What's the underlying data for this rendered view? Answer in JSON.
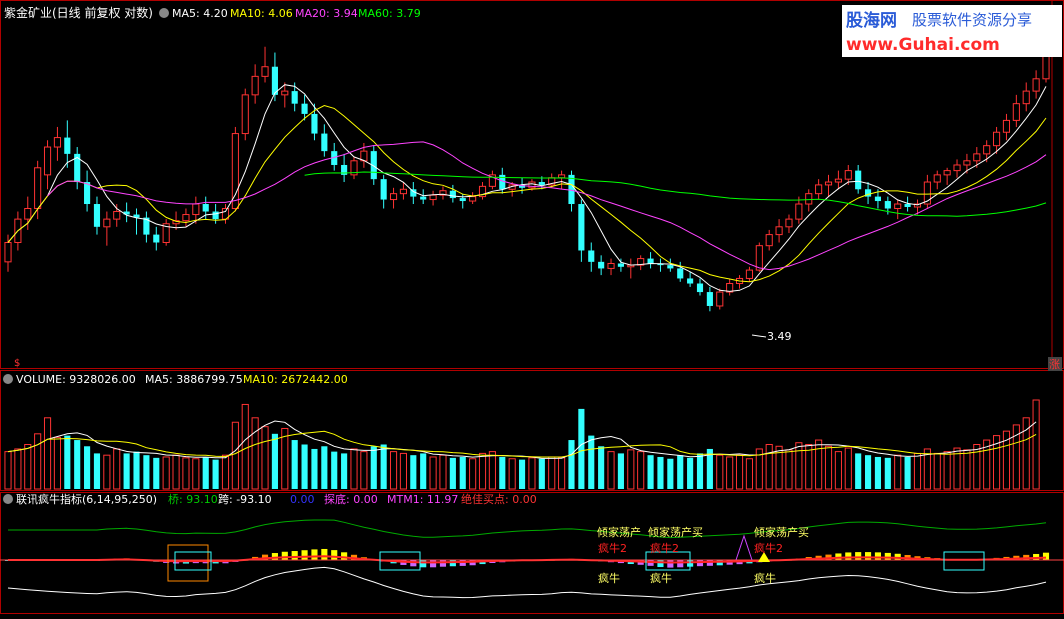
{
  "main_panel": {
    "title": "紫金矿业(日线 前复权 对数)",
    "ma_labels": [
      {
        "text": "MA5: 4.20",
        "color": "#ffffff"
      },
      {
        "text": "MA10: 4.06",
        "color": "#ffff00"
      },
      {
        "text": "MA20: 3.94",
        "color": "#ff44ff"
      },
      {
        "text": "MA60: 3.79",
        "color": "#00ff00"
      }
    ],
    "low_marker": "3.49",
    "left_flag": "$",
    "right_flag": "涨"
  },
  "volume_panel": {
    "labels": [
      {
        "text": "VOLUME: 9328026.00",
        "color": "#ffffff"
      },
      {
        "text": "MA5: 3886799.75",
        "color": "#ffffff"
      },
      {
        "text": "MA10: 2672442.00",
        "color": "#ffff00"
      }
    ]
  },
  "indicator_panel": {
    "labels": [
      {
        "text": "联讯疯牛指标(6,14,95,250)",
        "color": "#ffffff"
      },
      {
        "text": "桥: 93.10",
        "color": "#00cc00"
      },
      {
        "text": "跨: -93.10",
        "color": "#ffffff"
      },
      {
        "text": "0.00",
        "color": "#3333ff"
      },
      {
        "text": "探底: 0.00",
        "color": "#ff44ff"
      },
      {
        "text": "MTM1: 11.97",
        "color": "#ff44ff"
      },
      {
        "text": "绝佳买点: 0.00",
        "color": "#ff3333"
      }
    ],
    "signals": [
      {
        "text": "倾家荡产",
        "color": "#ffff66"
      },
      {
        "text": "疯牛2",
        "color": "#ff2222"
      },
      {
        "text": "疯牛",
        "color": "#ffff66"
      },
      {
        "text": "倾家荡产买",
        "color": "#ffff66"
      },
      {
        "text": "疯牛2",
        "color": "#ff2222"
      },
      {
        "text": "疯牛",
        "color": "#ffff66"
      },
      {
        "text": "倾家荡产买",
        "color": "#ffff66"
      },
      {
        "text": "疯牛2",
        "color": "#ff2222"
      },
      {
        "text": "疯牛",
        "color": "#ffff66"
      }
    ]
  },
  "watermark": {
    "brand": "股海网",
    "slogan": "股票软件资源分享",
    "url": "www.Guhai.com"
  },
  "colors": {
    "up": "#ff3333",
    "down": "#33ffff",
    "ma5": "#ffffff",
    "ma10": "#ffff00",
    "ma20": "#ff44ff",
    "ma60": "#00ff00",
    "frame": "#b00000"
  },
  "chart_data": {
    "type": "candlestick",
    "scale": "log",
    "ylim": [
      3.2,
      5.55
    ],
    "candles": [
      {
        "o": 3.78,
        "h": 3.95,
        "l": 3.72,
        "c": 3.9
      },
      {
        "o": 3.9,
        "h": 4.1,
        "l": 3.85,
        "c": 4.05
      },
      {
        "o": 4.05,
        "h": 4.2,
        "l": 3.98,
        "c": 4.12
      },
      {
        "o": 4.12,
        "h": 4.45,
        "l": 4.05,
        "c": 4.4
      },
      {
        "o": 4.35,
        "h": 4.6,
        "l": 4.25,
        "c": 4.55
      },
      {
        "o": 4.55,
        "h": 4.7,
        "l": 4.45,
        "c": 4.62
      },
      {
        "o": 4.62,
        "h": 4.75,
        "l": 4.4,
        "c": 4.5
      },
      {
        "o": 4.5,
        "h": 4.55,
        "l": 4.25,
        "c": 4.3
      },
      {
        "o": 4.3,
        "h": 4.38,
        "l": 4.1,
        "c": 4.15
      },
      {
        "o": 4.15,
        "h": 4.2,
        "l": 3.95,
        "c": 4.0
      },
      {
        "o": 4.0,
        "h": 4.1,
        "l": 3.88,
        "c": 4.05
      },
      {
        "o": 4.05,
        "h": 4.15,
        "l": 4.0,
        "c": 4.1
      },
      {
        "o": 4.1,
        "h": 4.16,
        "l": 4.03,
        "c": 4.08
      },
      {
        "o": 4.08,
        "h": 4.12,
        "l": 3.95,
        "c": 4.06
      },
      {
        "o": 4.06,
        "h": 4.1,
        "l": 3.9,
        "c": 3.95
      },
      {
        "o": 3.95,
        "h": 4.0,
        "l": 3.85,
        "c": 3.9
      },
      {
        "o": 3.9,
        "h": 4.05,
        "l": 3.88,
        "c": 4.02
      },
      {
        "o": 4.02,
        "h": 4.1,
        "l": 3.98,
        "c": 4.04
      },
      {
        "o": 4.04,
        "h": 4.12,
        "l": 4.0,
        "c": 4.08
      },
      {
        "o": 4.08,
        "h": 4.2,
        "l": 4.02,
        "c": 4.15
      },
      {
        "o": 4.15,
        "h": 4.2,
        "l": 4.05,
        "c": 4.1
      },
      {
        "o": 4.1,
        "h": 4.15,
        "l": 4.02,
        "c": 4.05
      },
      {
        "o": 4.05,
        "h": 4.15,
        "l": 4.02,
        "c": 4.12
      },
      {
        "o": 4.12,
        "h": 4.7,
        "l": 4.1,
        "c": 4.65
      },
      {
        "o": 4.65,
        "h": 5.0,
        "l": 4.6,
        "c": 4.95
      },
      {
        "o": 4.95,
        "h": 5.2,
        "l": 4.88,
        "c": 5.1
      },
      {
        "o": 5.1,
        "h": 5.35,
        "l": 5.05,
        "c": 5.18
      },
      {
        "o": 5.18,
        "h": 5.3,
        "l": 4.9,
        "c": 4.95
      },
      {
        "o": 4.95,
        "h": 5.05,
        "l": 4.85,
        "c": 4.98
      },
      {
        "o": 4.98,
        "h": 5.05,
        "l": 4.82,
        "c": 4.88
      },
      {
        "o": 4.88,
        "h": 4.95,
        "l": 4.75,
        "c": 4.8
      },
      {
        "o": 4.8,
        "h": 4.88,
        "l": 4.6,
        "c": 4.65
      },
      {
        "o": 4.65,
        "h": 4.72,
        "l": 4.48,
        "c": 4.52
      },
      {
        "o": 4.52,
        "h": 4.58,
        "l": 4.38,
        "c": 4.42
      },
      {
        "o": 4.42,
        "h": 4.5,
        "l": 4.3,
        "c": 4.35
      },
      {
        "o": 4.35,
        "h": 4.48,
        "l": 4.32,
        "c": 4.45
      },
      {
        "o": 4.45,
        "h": 4.58,
        "l": 4.4,
        "c": 4.52
      },
      {
        "o": 4.52,
        "h": 4.56,
        "l": 4.28,
        "c": 4.32
      },
      {
        "o": 4.32,
        "h": 4.35,
        "l": 4.12,
        "c": 4.18
      },
      {
        "o": 4.18,
        "h": 4.26,
        "l": 4.12,
        "c": 4.22
      },
      {
        "o": 4.22,
        "h": 4.3,
        "l": 4.18,
        "c": 4.25
      },
      {
        "o": 4.25,
        "h": 4.3,
        "l": 4.15,
        "c": 4.2
      },
      {
        "o": 4.2,
        "h": 4.25,
        "l": 4.15,
        "c": 4.18
      },
      {
        "o": 4.18,
        "h": 4.24,
        "l": 4.14,
        "c": 4.21
      },
      {
        "o": 4.21,
        "h": 4.27,
        "l": 4.18,
        "c": 4.24
      },
      {
        "o": 4.24,
        "h": 4.28,
        "l": 4.16,
        "c": 4.19
      },
      {
        "o": 4.19,
        "h": 4.22,
        "l": 4.12,
        "c": 4.17
      },
      {
        "o": 4.17,
        "h": 4.23,
        "l": 4.15,
        "c": 4.2
      },
      {
        "o": 4.2,
        "h": 4.3,
        "l": 4.18,
        "c": 4.27
      },
      {
        "o": 4.27,
        "h": 4.38,
        "l": 4.25,
        "c": 4.35
      },
      {
        "o": 4.35,
        "h": 4.4,
        "l": 4.22,
        "c": 4.25
      },
      {
        "o": 4.25,
        "h": 4.3,
        "l": 4.2,
        "c": 4.28
      },
      {
        "o": 4.28,
        "h": 4.33,
        "l": 4.22,
        "c": 4.26
      },
      {
        "o": 4.26,
        "h": 4.32,
        "l": 4.24,
        "c": 4.3
      },
      {
        "o": 4.3,
        "h": 4.34,
        "l": 4.25,
        "c": 4.28
      },
      {
        "o": 4.28,
        "h": 4.36,
        "l": 4.26,
        "c": 4.33
      },
      {
        "o": 4.33,
        "h": 4.38,
        "l": 4.25,
        "c": 4.35
      },
      {
        "o": 4.35,
        "h": 4.38,
        "l": 4.1,
        "c": 4.15
      },
      {
        "o": 4.15,
        "h": 4.18,
        "l": 3.78,
        "c": 3.85
      },
      {
        "o": 3.85,
        "h": 3.9,
        "l": 3.72,
        "c": 3.78
      },
      {
        "o": 3.78,
        "h": 3.82,
        "l": 3.7,
        "c": 3.74
      },
      {
        "o": 3.74,
        "h": 3.8,
        "l": 3.7,
        "c": 3.77
      },
      {
        "o": 3.77,
        "h": 3.8,
        "l": 3.72,
        "c": 3.75
      },
      {
        "o": 3.75,
        "h": 3.8,
        "l": 3.68,
        "c": 3.76
      },
      {
        "o": 3.76,
        "h": 3.82,
        "l": 3.73,
        "c": 3.8
      },
      {
        "o": 3.8,
        "h": 3.84,
        "l": 3.74,
        "c": 3.77
      },
      {
        "o": 3.77,
        "h": 3.8,
        "l": 3.72,
        "c": 3.76
      },
      {
        "o": 3.76,
        "h": 3.8,
        "l": 3.72,
        "c": 3.74
      },
      {
        "o": 3.74,
        "h": 3.78,
        "l": 3.66,
        "c": 3.68
      },
      {
        "o": 3.68,
        "h": 3.72,
        "l": 3.63,
        "c": 3.65
      },
      {
        "o": 3.65,
        "h": 3.68,
        "l": 3.58,
        "c": 3.6
      },
      {
        "o": 3.6,
        "h": 3.63,
        "l": 3.49,
        "c": 3.52
      },
      {
        "o": 3.52,
        "h": 3.62,
        "l": 3.5,
        "c": 3.6
      },
      {
        "o": 3.6,
        "h": 3.68,
        "l": 3.58,
        "c": 3.65
      },
      {
        "o": 3.65,
        "h": 3.7,
        "l": 3.62,
        "c": 3.68
      },
      {
        "o": 3.68,
        "h": 3.75,
        "l": 3.66,
        "c": 3.73
      },
      {
        "o": 3.73,
        "h": 3.9,
        "l": 3.72,
        "c": 3.88
      },
      {
        "o": 3.88,
        "h": 3.98,
        "l": 3.85,
        "c": 3.95
      },
      {
        "o": 3.95,
        "h": 4.05,
        "l": 3.9,
        "c": 4.0
      },
      {
        "o": 4.0,
        "h": 4.08,
        "l": 3.96,
        "c": 4.05
      },
      {
        "o": 4.05,
        "h": 4.2,
        "l": 4.02,
        "c": 4.15
      },
      {
        "o": 4.15,
        "h": 4.25,
        "l": 4.1,
        "c": 4.22
      },
      {
        "o": 4.22,
        "h": 4.32,
        "l": 4.18,
        "c": 4.28
      },
      {
        "o": 4.28,
        "h": 4.35,
        "l": 4.2,
        "c": 4.3
      },
      {
        "o": 4.3,
        "h": 4.38,
        "l": 4.25,
        "c": 4.32
      },
      {
        "o": 4.32,
        "h": 4.42,
        "l": 4.28,
        "c": 4.38
      },
      {
        "o": 4.38,
        "h": 4.42,
        "l": 4.22,
        "c": 4.25
      },
      {
        "o": 4.25,
        "h": 4.3,
        "l": 4.15,
        "c": 4.2
      },
      {
        "o": 4.2,
        "h": 4.25,
        "l": 4.12,
        "c": 4.17
      },
      {
        "o": 4.17,
        "h": 4.2,
        "l": 4.08,
        "c": 4.12
      },
      {
        "o": 4.12,
        "h": 4.18,
        "l": 4.05,
        "c": 4.15
      },
      {
        "o": 4.15,
        "h": 4.2,
        "l": 4.1,
        "c": 4.13
      },
      {
        "o": 4.13,
        "h": 4.18,
        "l": 4.08,
        "c": 4.15
      },
      {
        "o": 4.15,
        "h": 4.35,
        "l": 4.12,
        "c": 4.3
      },
      {
        "o": 4.3,
        "h": 4.38,
        "l": 4.25,
        "c": 4.35
      },
      {
        "o": 4.35,
        "h": 4.4,
        "l": 4.28,
        "c": 4.38
      },
      {
        "o": 4.38,
        "h": 4.46,
        "l": 4.33,
        "c": 4.42
      },
      {
        "o": 4.42,
        "h": 4.5,
        "l": 4.36,
        "c": 4.45
      },
      {
        "o": 4.45,
        "h": 4.55,
        "l": 4.4,
        "c": 4.5
      },
      {
        "o": 4.5,
        "h": 4.6,
        "l": 4.44,
        "c": 4.56
      },
      {
        "o": 4.56,
        "h": 4.7,
        "l": 4.5,
        "c": 4.66
      },
      {
        "o": 4.66,
        "h": 4.8,
        "l": 4.6,
        "c": 4.75
      },
      {
        "o": 4.75,
        "h": 4.95,
        "l": 4.7,
        "c": 4.88
      },
      {
        "o": 4.88,
        "h": 5.05,
        "l": 4.82,
        "c": 4.98
      },
      {
        "o": 4.98,
        "h": 5.15,
        "l": 4.92,
        "c": 5.08
      },
      {
        "o": 5.08,
        "h": 5.45,
        "l": 5.05,
        "c": 5.4
      }
    ],
    "volume": [
      0.42,
      0.45,
      0.5,
      0.62,
      0.8,
      0.58,
      0.6,
      0.55,
      0.48,
      0.4,
      0.38,
      0.45,
      0.4,
      0.42,
      0.38,
      0.35,
      0.36,
      0.38,
      0.35,
      0.34,
      0.36,
      0.33,
      0.38,
      0.75,
      0.95,
      0.8,
      0.7,
      0.62,
      0.68,
      0.55,
      0.5,
      0.45,
      0.48,
      0.42,
      0.4,
      0.45,
      0.42,
      0.48,
      0.5,
      0.42,
      0.4,
      0.38,
      0.4,
      0.36,
      0.38,
      0.35,
      0.36,
      0.34,
      0.4,
      0.42,
      0.36,
      0.34,
      0.33,
      0.35,
      0.34,
      0.36,
      0.35,
      0.55,
      0.9,
      0.6,
      0.48,
      0.42,
      0.4,
      0.44,
      0.42,
      0.38,
      0.36,
      0.34,
      0.38,
      0.35,
      0.4,
      0.45,
      0.38,
      0.36,
      0.38,
      0.34,
      0.45,
      0.5,
      0.48,
      0.44,
      0.52,
      0.5,
      0.55,
      0.48,
      0.42,
      0.46,
      0.4,
      0.38,
      0.36,
      0.35,
      0.38,
      0.36,
      0.4,
      0.45,
      0.4,
      0.42,
      0.46,
      0.44,
      0.5,
      0.55,
      0.6,
      0.65,
      0.72,
      0.8,
      1.0
    ]
  }
}
